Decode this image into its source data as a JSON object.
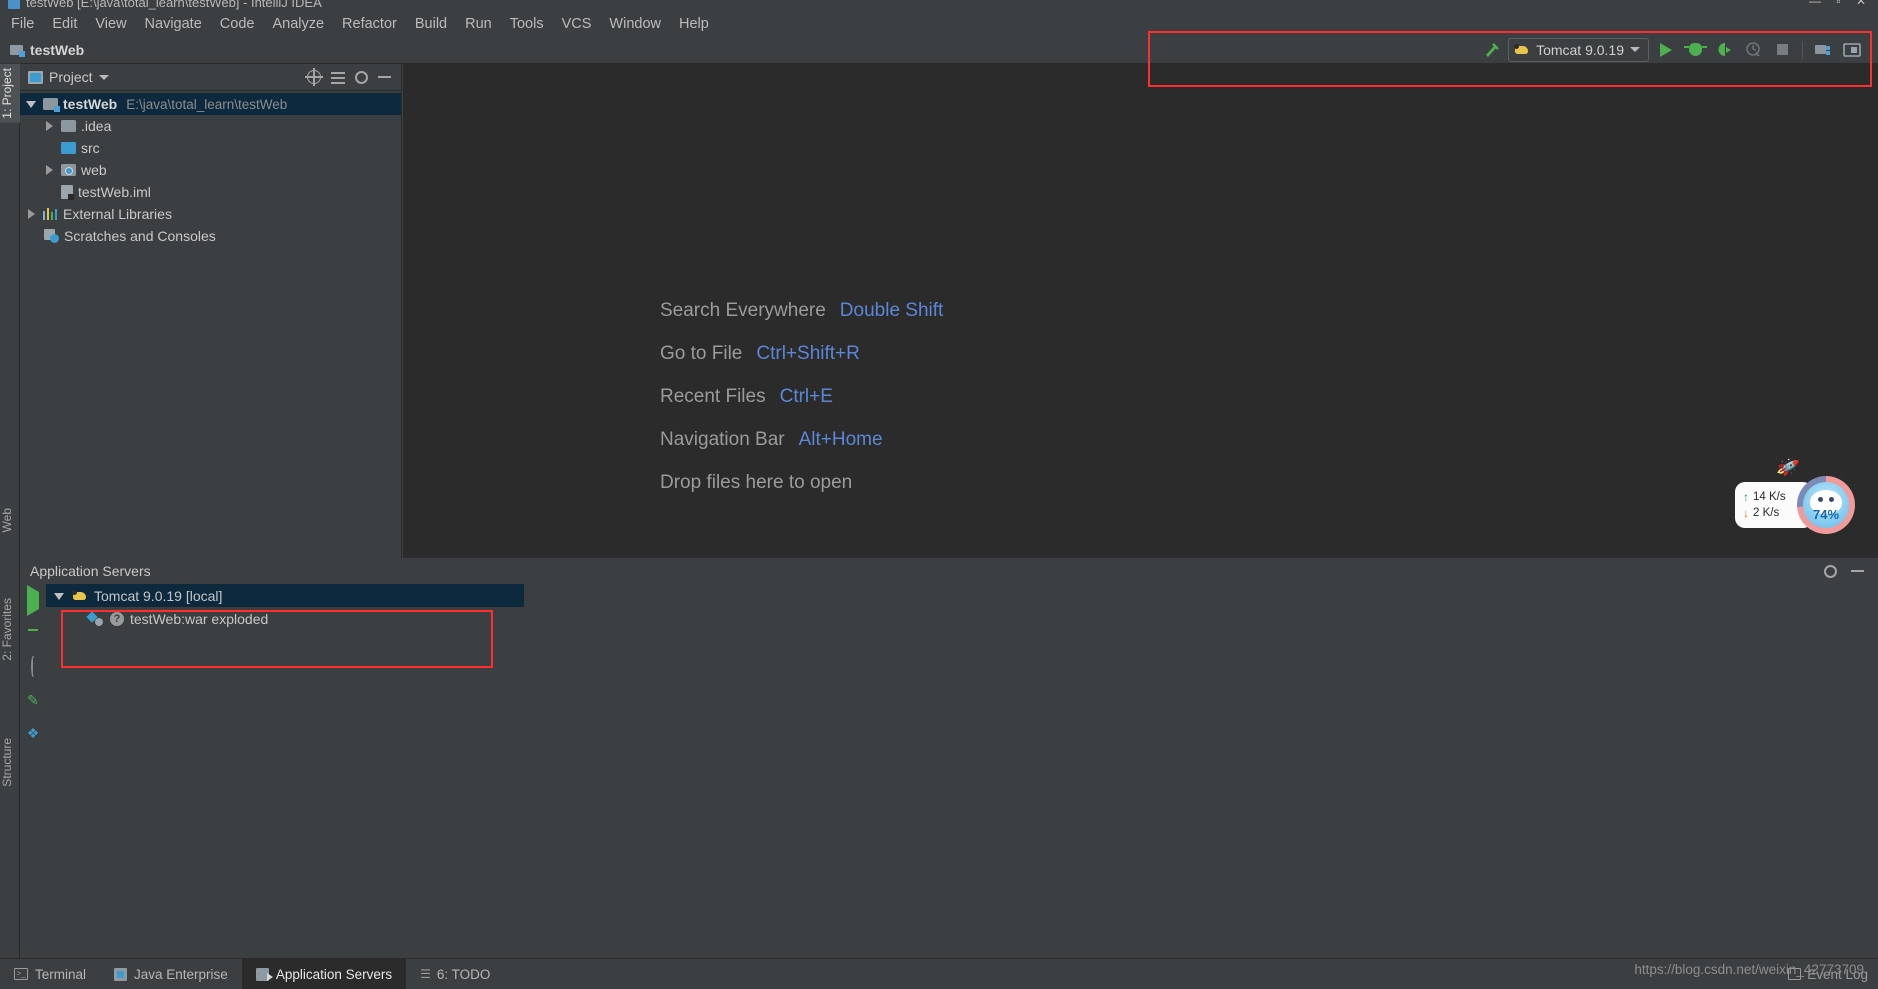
{
  "window": {
    "title": "testWeb [E:\\java\\total_learn\\testWeb] - IntelliJ IDEA",
    "controls": "— ▫ ✕"
  },
  "menubar": {
    "items": [
      {
        "label": "File"
      },
      {
        "label": "Edit"
      },
      {
        "label": "View"
      },
      {
        "label": "Navigate"
      },
      {
        "label": "Code"
      },
      {
        "label": "Analyze"
      },
      {
        "label": "Refactor"
      },
      {
        "label": "Build"
      },
      {
        "label": "Run"
      },
      {
        "label": "Tools"
      },
      {
        "label": "VCS"
      },
      {
        "label": "Window"
      },
      {
        "label": "Help"
      }
    ]
  },
  "navbar": {
    "breadcrumb": "testWeb"
  },
  "run_toolbar": {
    "build_icon": "hammer-icon",
    "config_name": "Tomcat 9.0.19",
    "buttons": [
      {
        "name": "run-button",
        "icon": "play-icon"
      },
      {
        "name": "debug-button",
        "icon": "bug-icon"
      },
      {
        "name": "run-with-coverage-button",
        "icon": "coverage-icon"
      },
      {
        "name": "profile-button",
        "icon": "profiler-icon"
      },
      {
        "name": "stop-button",
        "icon": "stop-icon"
      },
      {
        "name": "project-structure-button",
        "icon": "project-structure-icon"
      },
      {
        "name": "search-everywhere-button",
        "icon": "layout-icon"
      }
    ]
  },
  "left_rail": {
    "tabs": [
      {
        "label": "1: Project",
        "active": true
      },
      {
        "label": "Web",
        "active": false
      },
      {
        "label": "2: Favorites",
        "active": false
      },
      {
        "label": "Structure",
        "active": false
      }
    ]
  },
  "project_panel": {
    "title": "Project",
    "actions": [
      {
        "name": "select-opened-file-icon"
      },
      {
        "name": "collapse-all-icon"
      },
      {
        "name": "settings-gear-icon"
      },
      {
        "name": "hide-panel-icon"
      }
    ],
    "tree": [
      {
        "name": "testWeb",
        "path": "E:\\java\\total_learn\\testWeb",
        "icon": "module-folder-icon",
        "indent": 0,
        "twisty": "open",
        "selected": true,
        "bold": true
      },
      {
        "name": ".idea",
        "path": "",
        "icon": "folder-icon",
        "indent": 1,
        "twisty": "closed",
        "selected": false,
        "bold": false
      },
      {
        "name": "src",
        "path": "",
        "icon": "source-folder-icon",
        "indent": 1,
        "twisty": "none",
        "selected": false,
        "bold": false
      },
      {
        "name": "web",
        "path": "",
        "icon": "web-folder-icon",
        "indent": 1,
        "twisty": "closed",
        "selected": false,
        "bold": false
      },
      {
        "name": "testWeb.iml",
        "path": "",
        "icon": "iml-file-icon",
        "indent": 1,
        "twisty": "none",
        "selected": false,
        "bold": false
      },
      {
        "name": "External Libraries",
        "path": "",
        "icon": "libraries-icon",
        "indent": 0,
        "twisty": "closed",
        "selected": false,
        "bold": false
      },
      {
        "name": "Scratches and Consoles",
        "path": "",
        "icon": "scratches-icon",
        "indent": 0,
        "twisty": "none",
        "selected": false,
        "bold": false
      }
    ]
  },
  "editor": {
    "hints": [
      {
        "label": "Search Everywhere",
        "key": "Double Shift"
      },
      {
        "label": "Go to File",
        "key": "Ctrl+Shift+R"
      },
      {
        "label": "Recent Files",
        "key": "Ctrl+E"
      },
      {
        "label": "Navigation Bar",
        "key": "Alt+Home"
      },
      {
        "label": "Drop files here to open",
        "key": ""
      }
    ]
  },
  "net_widget": {
    "upload": "14  K/s",
    "download": "2  K/s",
    "up_arrow": "↑",
    "down_arrow": "↓",
    "percent": "74%",
    "rocket": "🚀"
  },
  "app_servers": {
    "title": "Application Servers",
    "rail_buttons": [
      {
        "name": "run-server-button",
        "icon": "play-icon"
      },
      {
        "name": "debug-server-button",
        "icon": "bug-icon"
      },
      {
        "name": "stop-server-button",
        "icon": "stop-icon"
      },
      {
        "name": "rerun-button",
        "icon": "rerun-icon"
      },
      {
        "name": "edit-configuration-button",
        "icon": "pencil-icon"
      },
      {
        "name": "settings-button",
        "icon": "diamond-icon"
      }
    ],
    "header_actions": [
      {
        "name": "settings-gear-icon"
      },
      {
        "name": "hide-panel-icon"
      }
    ],
    "tree": [
      {
        "label": "Tomcat 9.0.19 [local]",
        "icon": "tomcat-cat-icon",
        "indent": 0,
        "twisty": "open",
        "selected": true
      },
      {
        "label": "testWeb:war exploded",
        "icon": "artifact-icon",
        "indent": 1,
        "twisty": "none",
        "selected": false,
        "badge": "?"
      }
    ]
  },
  "statusbar": {
    "tabs": [
      {
        "label": "Terminal",
        "icon": "terminal-icon",
        "active": false
      },
      {
        "label": "Java Enterprise",
        "icon": "java-enterprise-icon",
        "active": false
      },
      {
        "label": "Application Servers",
        "icon": "application-servers-icon",
        "active": true
      },
      {
        "label": "6: TODO",
        "icon": "todo-icon",
        "active": false
      }
    ],
    "event_log": "Event Log",
    "watermark": "https://blog.csdn.net/weixin_42773709"
  },
  "colors": {
    "accent_blue": "#3c9cd0",
    "selection": "#0d293e",
    "highlight_red": "#ff2d2d",
    "run_green": "#4caf50",
    "link_blue": "#5c87d6"
  }
}
